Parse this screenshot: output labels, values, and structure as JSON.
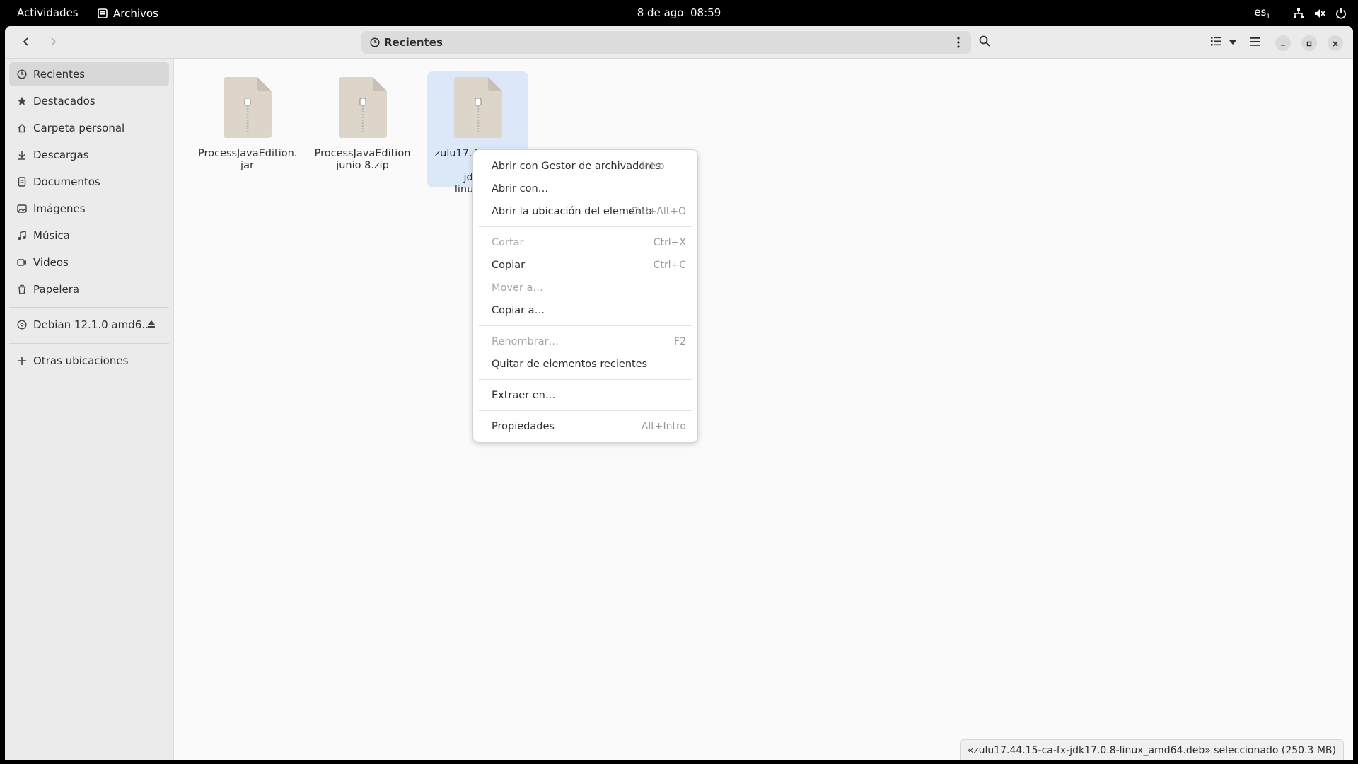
{
  "topbar": {
    "activities": "Actividades",
    "app_name": "Archivos",
    "datetime": "8 de ago  08:59",
    "language": "es",
    "language_sub": "1"
  },
  "headerbar": {
    "location": "Recientes"
  },
  "sidebar": {
    "items": [
      {
        "label": "Recientes",
        "icon": "clock-icon"
      },
      {
        "label": "Destacados",
        "icon": "star-icon"
      },
      {
        "label": "Carpeta personal",
        "icon": "home-icon"
      },
      {
        "label": "Descargas",
        "icon": "download-icon"
      },
      {
        "label": "Documentos",
        "icon": "document-icon"
      },
      {
        "label": "Imágenes",
        "icon": "image-icon"
      },
      {
        "label": "Música",
        "icon": "music-icon"
      },
      {
        "label": "Videos",
        "icon": "video-icon"
      },
      {
        "label": "Papelera",
        "icon": "trash-icon"
      }
    ],
    "device": "Debian 12.1.0 amd6…",
    "other_locations": "Otras ubicaciones"
  },
  "files": [
    {
      "line1": "ProcessJavaEdition.",
      "line2": "jar"
    },
    {
      "line1": "ProcessJavaEdition",
      "line2": "junio 8.zip"
    },
    {
      "line1": "zulu17.44.15-ca-fx-",
      "line2": "jdk17",
      "line3": "linux_am"
    }
  ],
  "context_menu": {
    "items": [
      {
        "label": "Abrir con Gestor de archivadores",
        "accel": "Intro"
      },
      {
        "label": "Abrir con…",
        "accel": ""
      },
      {
        "label": "Abrir la ubicación del elemento",
        "accel": "Ctrl+Alt+O"
      },
      {
        "label": "Cortar",
        "accel": "Ctrl+X"
      },
      {
        "label": "Copiar",
        "accel": "Ctrl+C"
      },
      {
        "label": "Mover a…",
        "accel": ""
      },
      {
        "label": "Copiar a…",
        "accel": ""
      },
      {
        "label": "Renombrar…",
        "accel": "F2"
      },
      {
        "label": "Quitar de elementos recientes",
        "accel": ""
      },
      {
        "label": "Extraer en…",
        "accel": ""
      },
      {
        "label": "Propiedades",
        "accel": "Alt+Intro"
      }
    ]
  },
  "status": "«zulu17.44.15-ca-fx-jdk17.0.8-linux_amd64.deb» seleccionado  (250.3 MB)"
}
